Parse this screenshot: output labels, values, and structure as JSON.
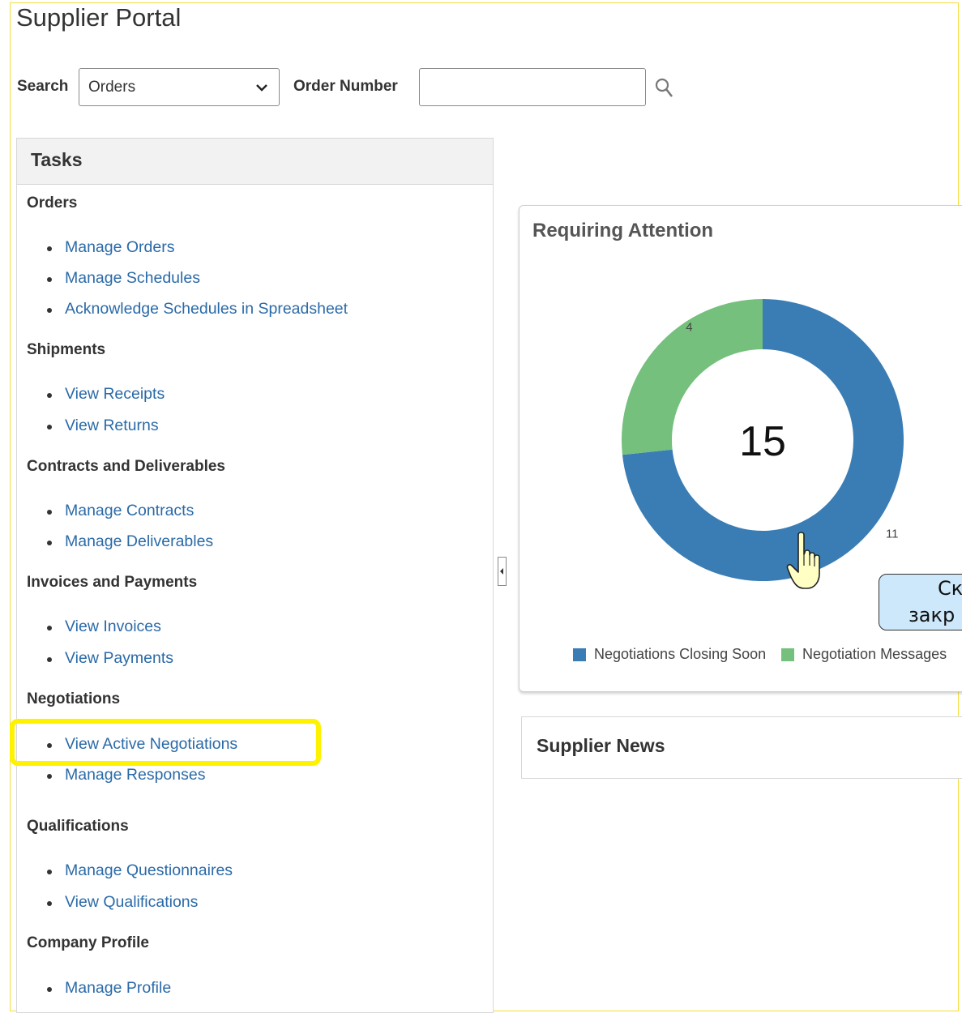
{
  "page": {
    "title": "Supplier Portal"
  },
  "search": {
    "label": "Search",
    "selected": "Orders",
    "order_label": "Order Number",
    "order_value": ""
  },
  "tasks": {
    "title": "Tasks",
    "groups": [
      {
        "title": "Orders",
        "items": [
          "Manage Orders",
          "Manage Schedules",
          "Acknowledge Schedules in Spreadsheet"
        ]
      },
      {
        "title": "Shipments",
        "items": [
          "View Receipts",
          "View Returns"
        ]
      },
      {
        "title": "Contracts and Deliverables",
        "items": [
          "Manage Contracts",
          "Manage Deliverables"
        ]
      },
      {
        "title": "Invoices and Payments",
        "items": [
          "View Invoices",
          "View Payments"
        ]
      },
      {
        "title": "Negotiations",
        "items": [
          "View Active Negotiations",
          "Manage Responses"
        ]
      },
      {
        "title": "Qualifications",
        "items": [
          "Manage Questionnaires",
          "View Qualifications"
        ]
      },
      {
        "title": "Company Profile",
        "items": [
          "Manage Profile"
        ]
      }
    ]
  },
  "attention": {
    "title": "Requiring Attention",
    "total": "15",
    "colors": {
      "closing": "#3a7db5",
      "messages": "#74c07c"
    }
  },
  "chart_data": {
    "type": "pie",
    "title": "Requiring Attention",
    "center_label": "15",
    "series": [
      {
        "name": "Negotiations Closing Soon",
        "values": [
          11
        ]
      },
      {
        "name": "Negotiation Messages",
        "values": [
          4
        ]
      }
    ],
    "labels": [
      "11",
      "4"
    ],
    "legend_position": "bottom"
  },
  "tooltip": {
    "line1": "Ск",
    "line2": "закр"
  },
  "news": {
    "title": "Supplier News"
  }
}
